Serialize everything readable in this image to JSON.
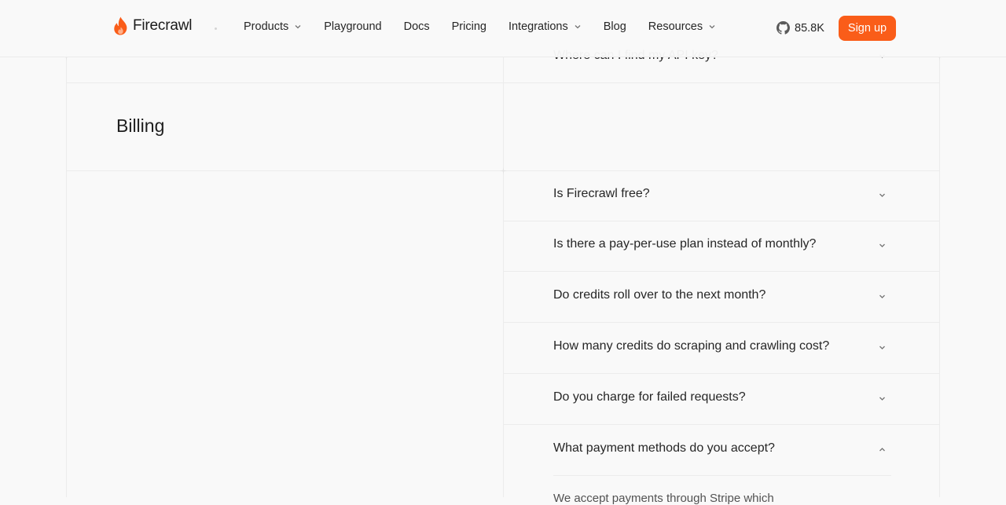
{
  "header": {
    "logo_text": "Firecrawl",
    "nav": [
      {
        "label": "Products",
        "has_dropdown": true
      },
      {
        "label": "Playground",
        "has_dropdown": false
      },
      {
        "label": "Docs",
        "has_dropdown": false
      },
      {
        "label": "Pricing",
        "has_dropdown": false
      },
      {
        "label": "Integrations",
        "has_dropdown": true
      },
      {
        "label": "Blog",
        "has_dropdown": false
      },
      {
        "label": "Resources",
        "has_dropdown": true
      }
    ],
    "github_stars": "85.8K",
    "signup_label": "Sign up"
  },
  "previous_section": {
    "last_question": "Where can I find my API key?"
  },
  "billing": {
    "title": "Billing",
    "questions": [
      {
        "question": "Is Firecrawl free?",
        "expanded": false
      },
      {
        "question": "Is there a pay-per-use plan instead of monthly?",
        "expanded": false
      },
      {
        "question": "Do credits roll over to the next month?",
        "expanded": false
      },
      {
        "question": "How many credits do scraping and crawling cost?",
        "expanded": false
      },
      {
        "question": "Do you charge for failed requests?",
        "expanded": false
      },
      {
        "question": "What payment methods do you accept?",
        "expanded": true
      }
    ],
    "expanded_answer_visible": "We accept payments through Stripe which"
  },
  "colors": {
    "accent": "#fa5d19",
    "background": "#f9f9f9",
    "border": "#ececec",
    "text": "#262626"
  }
}
